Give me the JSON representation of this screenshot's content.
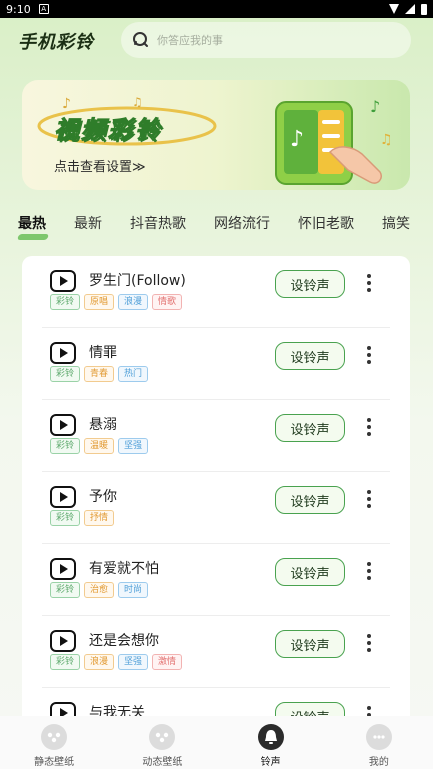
{
  "status_bar": {
    "time": "9:10",
    "badge": "A"
  },
  "header": {
    "logo": "手机彩铃",
    "search_placeholder": "你答应我的事"
  },
  "banner": {
    "title": "视频彩铃",
    "subtitle": "点击查看设置≫"
  },
  "tabs": [
    {
      "label": "最热",
      "active": true
    },
    {
      "label": "最新"
    },
    {
      "label": "抖音热歌"
    },
    {
      "label": "网络流行"
    },
    {
      "label": "怀旧老歌"
    },
    {
      "label": "搞笑"
    }
  ],
  "songs": [
    {
      "title": "罗生门(Follow)",
      "tags": [
        {
          "text": "彩铃",
          "color": "green"
        },
        {
          "text": "原唱",
          "color": "orange"
        },
        {
          "text": "浪漫",
          "color": "blue"
        },
        {
          "text": "情歌",
          "color": "red"
        }
      ]
    },
    {
      "title": "情罪",
      "tags": [
        {
          "text": "彩铃",
          "color": "green"
        },
        {
          "text": "青春",
          "color": "orange"
        },
        {
          "text": "热门",
          "color": "blue"
        }
      ]
    },
    {
      "title": "悬溺",
      "tags": [
        {
          "text": "彩铃",
          "color": "green"
        },
        {
          "text": "温暖",
          "color": "orange"
        },
        {
          "text": "坚强",
          "color": "blue"
        }
      ]
    },
    {
      "title": "予你",
      "tags": [
        {
          "text": "彩铃",
          "color": "green"
        },
        {
          "text": "抒情",
          "color": "orange"
        }
      ]
    },
    {
      "title": "有爱就不怕",
      "tags": [
        {
          "text": "彩铃",
          "color": "green"
        },
        {
          "text": "治愈",
          "color": "orange"
        },
        {
          "text": "时尚",
          "color": "blue"
        }
      ]
    },
    {
      "title": "还是会想你",
      "tags": [
        {
          "text": "彩铃",
          "color": "green"
        },
        {
          "text": "浪漫",
          "color": "orange"
        },
        {
          "text": "坚强",
          "color": "blue"
        },
        {
          "text": "激情",
          "color": "red"
        }
      ]
    },
    {
      "title": "与我无关",
      "tags": []
    }
  ],
  "set_button_label": "设铃声",
  "bottom_nav": [
    {
      "label": "静态壁纸"
    },
    {
      "label": "动态壁纸"
    },
    {
      "label": "铃声",
      "active": true
    },
    {
      "label": "我的"
    }
  ],
  "colors": {
    "accent": "#49a24f",
    "tab_underline": "#7ec76d"
  }
}
